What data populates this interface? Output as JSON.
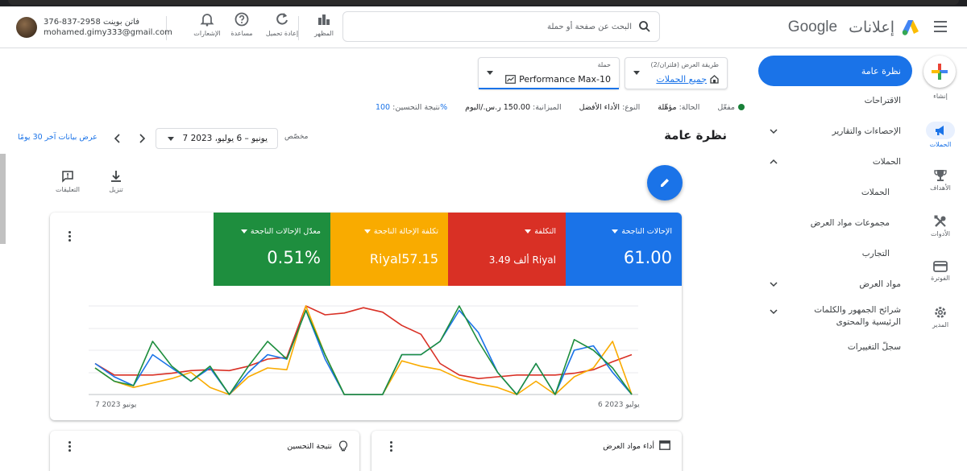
{
  "header": {
    "brand_text": "إعلانات",
    "brand_google": "Google",
    "search_placeholder": "البحث عن صفحة أو حملة",
    "actions": [
      {
        "label": "المظهر",
        "icon": "appearance-icon"
      },
      {
        "label": "إعادة تحميل",
        "icon": "refresh-icon"
      },
      {
        "label": "مساعدة",
        "icon": "help-icon"
      },
      {
        "label": "الإشعارات",
        "icon": "bell-icon"
      }
    ],
    "account": {
      "line1": "376-837-2958 فاتن بوينت",
      "email": "mohamed.gimy333@gmail.com"
    }
  },
  "rail": [
    {
      "label": "إنشاء",
      "icon": "create-plus-icon"
    },
    {
      "label": "الحملات",
      "icon": "campaigns-megaphone-icon",
      "active": true
    },
    {
      "label": "الأهداف",
      "icon": "goals-trophy-icon"
    },
    {
      "label": "الأدوات",
      "icon": "tools-icon"
    },
    {
      "label": "الفوترة",
      "icon": "billing-card-icon"
    },
    {
      "label": "المدير",
      "icon": "admin-gear-icon"
    }
  ],
  "sidenav": {
    "active": "نظرة عامة",
    "items": [
      {
        "label": "الاقتراحات",
        "chevron": ""
      },
      {
        "label": "الإحصاءات والتقارير",
        "chevron": "down"
      },
      {
        "label": "الحملات",
        "chevron": "up"
      },
      {
        "label": "الحملات",
        "chevron": ""
      },
      {
        "label": "مجموعات مواد العرض",
        "chevron": ""
      },
      {
        "label": "التجارب",
        "chevron": ""
      },
      {
        "label": "مواد العرض",
        "chevron": "down"
      },
      {
        "label": "شرائح الجمهور والكلمات الرئيسية والمحتوى",
        "chevron": "down"
      },
      {
        "label": "سجلّ التغييرات",
        "chevron": ""
      }
    ]
  },
  "selectors": {
    "view": {
      "small": "طريقة العرض (فلتران/2)",
      "value": "جميع الحملات"
    },
    "campaign": {
      "small": "حملة",
      "value": "Performance Max-10"
    }
  },
  "status": {
    "state_label": "الحالة:",
    "state_value": "مؤهّلة",
    "enabled": "مفعّل",
    "type_label": "النوع:",
    "type_value": "الأداء الأفضل",
    "budget_label": "الميزانية:",
    "budget_value": "150.00 ر.س./اليوم",
    "optimization_label": "نتيجة التحسين:",
    "optimization_value": "100%"
  },
  "toolbar": {
    "title": "نظرة عامة",
    "custom": "مخصّص",
    "date_range": "7 يونيو – 6 يوليو، 2023",
    "last30": "عرض بيانات آخر 30 يومًا",
    "download": "تنزيل",
    "comments": "التعليقات"
  },
  "metrics": [
    {
      "label": "الإحالات الناجحة",
      "value": "61.00",
      "color": "#1a73e8"
    },
    {
      "label": "التكلفة",
      "value": "3.49 ألف Riyal",
      "color": "#d93025"
    },
    {
      "label": "تكلفة الإحالة الناجحة",
      "value": "Riyal57.15",
      "color": "#f9ab00"
    },
    {
      "label": "معدّل الإحالات الناجحة",
      "value": "0.51%",
      "color": "#1e8e3e"
    }
  ],
  "chart_data": {
    "type": "line",
    "x_start_label": "7 يونيو 2023",
    "x_end_label": "6 يوليو 2023",
    "y_scale": "relative (0-1)",
    "series": [
      {
        "name": "الإحالات الناجحة",
        "color": "#1a73e8",
        "values": [
          0.35,
          0.2,
          0.1,
          0.45,
          0.3,
          0.15,
          0.3,
          0.0,
          0.25,
          0.45,
          0.4,
          0.95,
          0.4,
          0.0,
          0.0,
          0.0,
          0.45,
          0.45,
          0.6,
          0.95,
          0.7,
          0.25,
          0.0,
          0.35,
          0.0,
          0.5,
          0.55,
          0.25,
          0.0
        ]
      },
      {
        "name": "التكلفة",
        "color": "#d93025",
        "values": [
          0.35,
          0.22,
          0.22,
          0.22,
          0.24,
          0.27,
          0.28,
          0.27,
          0.32,
          0.4,
          0.42,
          1.0,
          0.9,
          0.92,
          0.98,
          0.93,
          0.78,
          0.68,
          0.35,
          0.22,
          0.18,
          0.2,
          0.22,
          0.22,
          0.22,
          0.24,
          0.28,
          0.37,
          0.45
        ]
      },
      {
        "name": "تكلفة الإحالة الناجحة",
        "color": "#f9ab00",
        "values": [
          0.3,
          0.15,
          0.08,
          0.13,
          0.18,
          0.25,
          0.08,
          0.0,
          0.2,
          0.3,
          0.28,
          1.0,
          0.45,
          0.0,
          0.0,
          0.0,
          0.38,
          0.32,
          0.28,
          0.18,
          0.12,
          0.08,
          0.0,
          0.15,
          0.0,
          0.2,
          0.3,
          0.6,
          0.0
        ]
      },
      {
        "name": "معدّل الإحالات الناجحة",
        "color": "#1e8e3e",
        "values": [
          0.3,
          0.15,
          0.1,
          0.6,
          0.32,
          0.15,
          0.32,
          0.0,
          0.32,
          0.6,
          0.4,
          0.95,
          0.45,
          0.0,
          0.0,
          0.0,
          0.45,
          0.45,
          0.6,
          1.0,
          0.6,
          0.25,
          0.0,
          0.35,
          0.0,
          0.62,
          0.5,
          0.3,
          0.0
        ]
      }
    ]
  },
  "bottom_cards": [
    {
      "title": "نتيجة التحسين",
      "icon": "lightbulb-icon"
    },
    {
      "title": "أداء مواد العرض",
      "icon": "asset-panel-icon"
    }
  ]
}
